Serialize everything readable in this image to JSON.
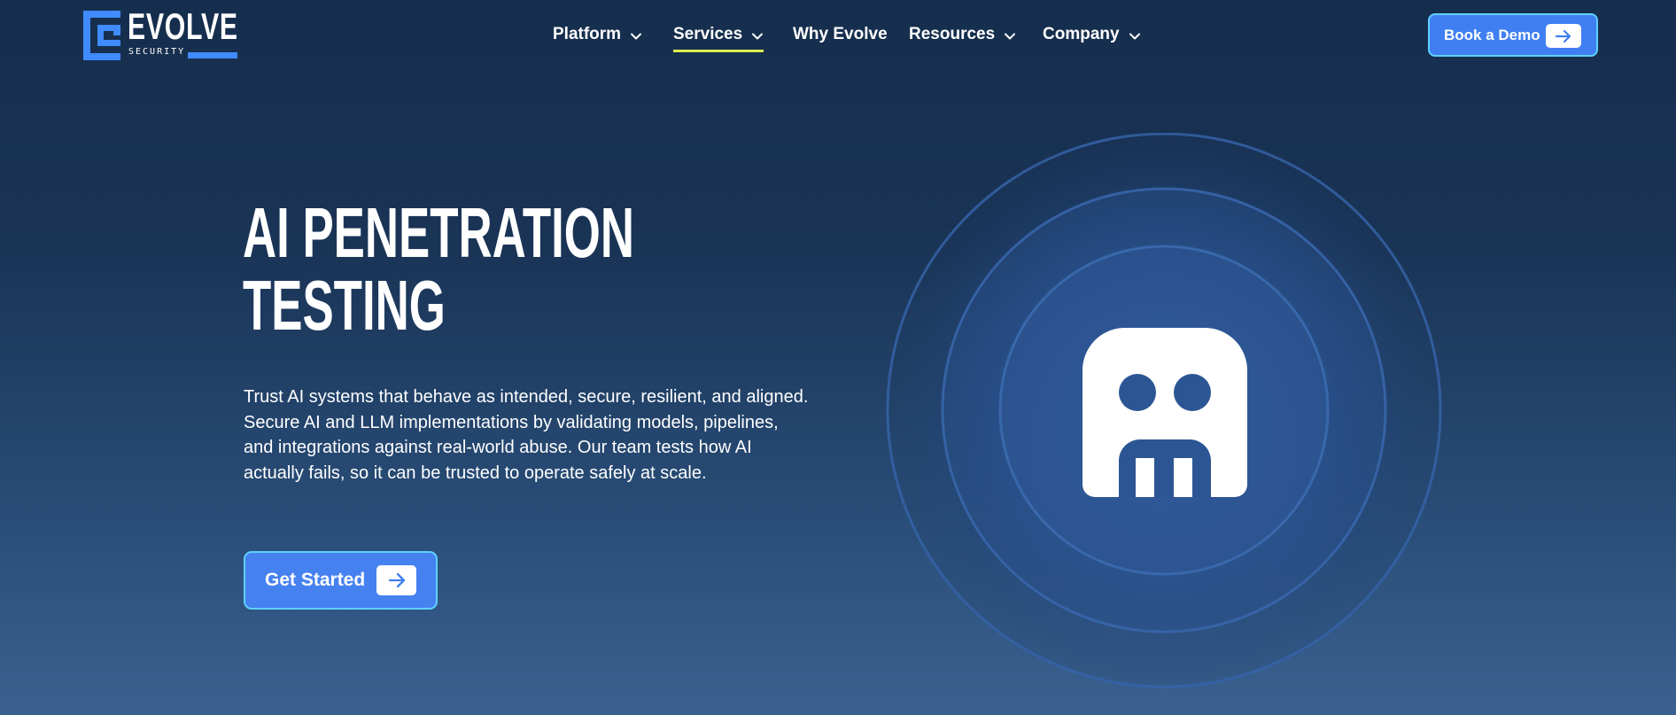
{
  "brand": {
    "name": "EVOLVE",
    "tagline": "SECURITY",
    "accent_color": "#3f8bff",
    "highlight_color": "#d9ec4c"
  },
  "nav": {
    "items": [
      {
        "label": "Platform",
        "has_dropdown": true
      },
      {
        "label": "Services",
        "has_dropdown": true,
        "active": true
      },
      {
        "label": "Why Evolve",
        "has_dropdown": false
      },
      {
        "label": "Resources",
        "has_dropdown": true
      },
      {
        "label": "Company",
        "has_dropdown": true
      }
    ],
    "cta_label": "Book a Demo",
    "cta_icon": "arrow-right-icon"
  },
  "hero": {
    "title_line1": "AI PENETRATION",
    "title_line2": "TESTING",
    "description": "Trust AI systems that behave as intended, secure, resilient, and aligned. Secure AI and LLM implementations by validating models, pipelines, and integrations against real-world abuse. Our team tests how AI actually fails, so it can be trusted to operate safely at scale.",
    "cta_label": "Get Started",
    "cta_icon": "arrow-right-icon",
    "illustration_icon": "ai-robot-icon"
  }
}
